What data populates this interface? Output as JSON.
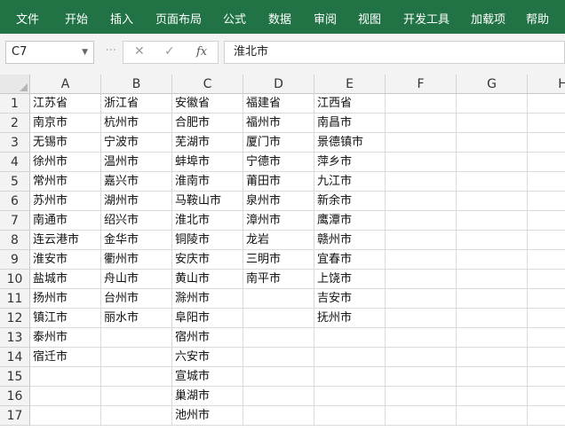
{
  "ribbon": {
    "tabs": [
      "文件",
      "开始",
      "插入",
      "页面布局",
      "公式",
      "数据",
      "审阅",
      "视图",
      "开发工具",
      "加载项",
      "帮助"
    ]
  },
  "formula_bar": {
    "name_box": "C7",
    "formula": "淮北市"
  },
  "columns": [
    "A",
    "B",
    "C",
    "D",
    "E",
    "F",
    "G",
    "H"
  ],
  "rows": [
    "1",
    "2",
    "3",
    "4",
    "5",
    "6",
    "7",
    "8",
    "9",
    "10",
    "11",
    "12",
    "13",
    "14",
    "15",
    "16",
    "17"
  ],
  "cells": [
    [
      "江苏省",
      "浙江省",
      "安徽省",
      "福建省",
      "江西省"
    ],
    [
      "南京市",
      "杭州市",
      "合肥市",
      "福州市",
      "南昌市"
    ],
    [
      "无锡市",
      "宁波市",
      "芜湖市",
      "厦门市",
      "景德镇市"
    ],
    [
      "徐州市",
      "温州市",
      "蚌埠市",
      "宁德市",
      "萍乡市"
    ],
    [
      "常州市",
      "嘉兴市",
      "淮南市",
      "莆田市",
      "九江市"
    ],
    [
      "苏州市",
      "湖州市",
      "马鞍山市",
      "泉州市",
      "新余市"
    ],
    [
      "南通市",
      "绍兴市",
      "淮北市",
      "漳州市",
      "鹰潭市"
    ],
    [
      "连云港市",
      "金华市",
      "铜陵市",
      "龙岩",
      "赣州市"
    ],
    [
      "淮安市",
      "衢州市",
      "安庆市",
      "三明市",
      "宜春市"
    ],
    [
      "盐城市",
      "舟山市",
      "黄山市",
      "南平市",
      "上饶市"
    ],
    [
      "扬州市",
      "台州市",
      "滁州市",
      "",
      "吉安市"
    ],
    [
      "镇江市",
      "丽水市",
      "阜阳市",
      "",
      "抚州市"
    ],
    [
      "泰州市",
      "",
      "宿州市",
      "",
      ""
    ],
    [
      "宿迁市",
      "",
      "六安市",
      "",
      ""
    ],
    [
      "",
      "",
      "宣城市",
      "",
      ""
    ],
    [
      "",
      "",
      "巢湖市",
      "",
      ""
    ],
    [
      "",
      "",
      "池州市",
      "",
      ""
    ]
  ]
}
